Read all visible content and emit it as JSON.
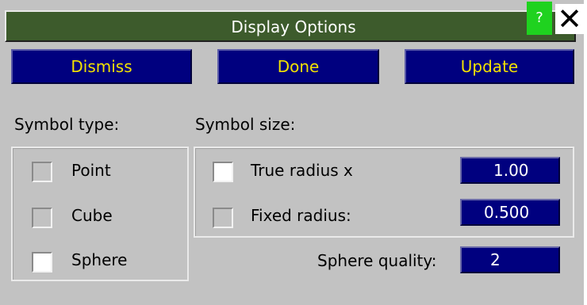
{
  "window": {
    "title": "Display Options",
    "help_label": "?",
    "close_label": "✕"
  },
  "buttons": {
    "dismiss": "Dismiss",
    "done": "Done",
    "update": "Update"
  },
  "symbol_type": {
    "label": "Symbol type:",
    "options": [
      {
        "label": "Point",
        "checked": false
      },
      {
        "label": "Cube",
        "checked": false
      },
      {
        "label": "Sphere",
        "checked": true
      }
    ]
  },
  "symbol_size": {
    "label": "Symbol size:",
    "true_radius": {
      "label": "True radius x",
      "checked": true,
      "value": "1.00"
    },
    "fixed_radius": {
      "label": "Fixed radius:",
      "checked": false,
      "value": "0.500"
    }
  },
  "sphere_quality": {
    "label": "Sphere quality:",
    "value": "2"
  },
  "colors": {
    "title_bg": "#3d5b2c",
    "button_bg": "#00007f",
    "button_text": "#f2e100",
    "panel_bg": "#c2c2c2",
    "help_bg": "#1fd21f"
  }
}
